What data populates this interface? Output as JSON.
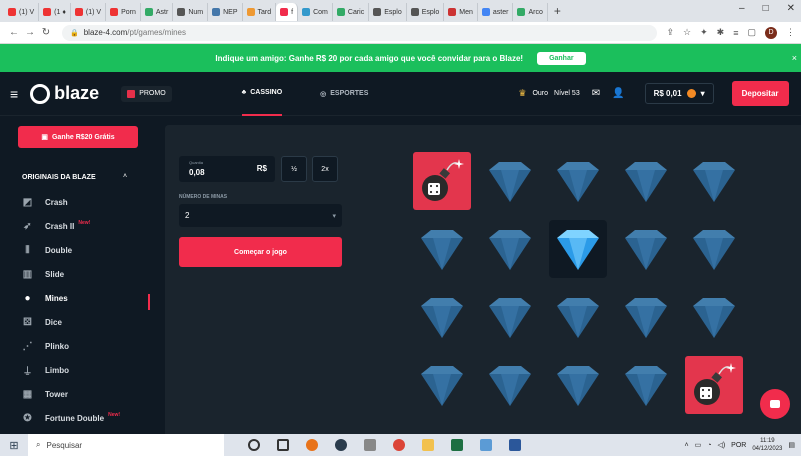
{
  "browser": {
    "tabs": [
      {
        "label": "(1) V",
        "color": "#e33"
      },
      {
        "label": "(1 ♦",
        "color": "#e33"
      },
      {
        "label": "(1) V",
        "color": "#e33"
      },
      {
        "label": "Porn",
        "color": "#e33"
      },
      {
        "label": "Astr",
        "color": "#3a6"
      },
      {
        "label": "Num",
        "color": "#555"
      },
      {
        "label": "NEP",
        "color": "#47a"
      },
      {
        "label": "Tard",
        "color": "#e93"
      },
      {
        "label": "f",
        "color": "#f12c4c",
        "active": true
      },
      {
        "label": "Com",
        "color": "#39c"
      },
      {
        "label": "Caric",
        "color": "#3a6"
      },
      {
        "label": "Esplo",
        "color": "#555"
      },
      {
        "label": "Esplo",
        "color": "#555"
      },
      {
        "label": "Men",
        "color": "#c33"
      },
      {
        "label": "aster",
        "color": "#4285f4"
      },
      {
        "label": "Arco",
        "color": "#3a6"
      }
    ],
    "new_tab": "+",
    "url_domain": "blaze-4.com",
    "url_path": "/pt/games/mines",
    "profile_letter": "D"
  },
  "banner": {
    "text": "Indique um amigo: Ganhe R$ 20 por cada amigo que você convidar para o Blaze!",
    "button": "Ganhar",
    "close": "×"
  },
  "header": {
    "logo_text": "blaze",
    "promo": "PROMO",
    "tab_casino": "CASSINO",
    "tab_esportes": "ESPORTES",
    "rank": "Ouro",
    "level": "Nível 53",
    "balance": "R$ 0,01",
    "deposit": "Depositar"
  },
  "sidebar": {
    "gift_button": "Ganhe R$20 Grátis",
    "section_title": "ORIGINAIS DA BLAZE",
    "items": [
      {
        "label": "Crash",
        "icon": "chart-icon",
        "new": ""
      },
      {
        "label": "Crash II",
        "icon": "rocket-icon",
        "new": "New!"
      },
      {
        "label": "Double",
        "icon": "double-icon",
        "new": ""
      },
      {
        "label": "Slide",
        "icon": "slide-icon",
        "new": ""
      },
      {
        "label": "Mines",
        "icon": "bomb-icon",
        "new": "",
        "active": true
      },
      {
        "label": "Dice",
        "icon": "dice-icon",
        "new": ""
      },
      {
        "label": "Plinko",
        "icon": "plinko-icon",
        "new": ""
      },
      {
        "label": "Limbo",
        "icon": "limbo-icon",
        "new": ""
      },
      {
        "label": "Tower",
        "icon": "tower-icon",
        "new": ""
      },
      {
        "label": "Fortune Double",
        "icon": "fortune-icon",
        "new": "New!"
      }
    ]
  },
  "controls": {
    "amount_label": "Quantia",
    "amount_value": "0,08",
    "currency": "R$",
    "half": "½",
    "double": "2x",
    "mines_label": "NÚMERO DE MINAS",
    "mines_value": "2",
    "start_button": "Começar o jogo"
  },
  "board": {
    "tiles": [
      "bomb",
      "gem",
      "gem",
      "gem",
      "gem",
      "gem",
      "gem",
      "gem-revealed",
      "gem",
      "gem",
      "gem",
      "gem",
      "gem",
      "gem",
      "gem",
      "gem",
      "gem",
      "gem",
      "gem",
      "bomb"
    ]
  },
  "taskbar": {
    "search": "Pesquisar",
    "lang": "POR",
    "time": "11:19",
    "date": "04/12/2023"
  },
  "colors": {
    "accent": "#f12c4c",
    "banner": "#1bbf5c",
    "bg": "#0f1923",
    "panel": "#1a242d",
    "gem": "#2f7fbf"
  }
}
